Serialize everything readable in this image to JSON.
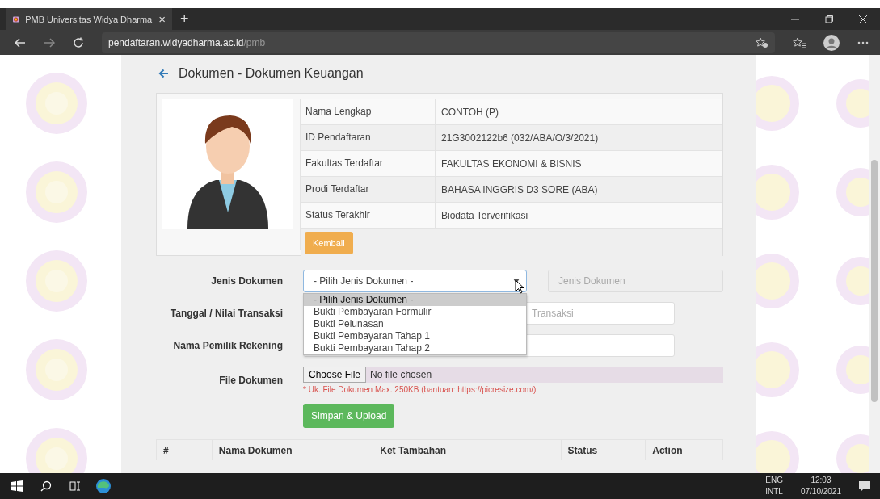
{
  "browser": {
    "tab": {
      "title": "PMB Universitas Widya Dharma",
      "close": "×"
    },
    "new_tab": "+",
    "address": {
      "host": "pendaftaran.widyadharma.ac.id",
      "path": "/pmb"
    }
  },
  "page": {
    "title": "Dokumen - Dokumen Keuangan",
    "profile": {
      "rows": [
        {
          "label": "Nama Lengkap",
          "value": "CONTOH (P)"
        },
        {
          "label": "ID Pendaftaran",
          "value": "21G3002122b6 (032/ABA/O/3/2021)"
        },
        {
          "label": "Fakultas Terdaftar",
          "value": "FAKULTAS EKONOMI & BISNIS"
        },
        {
          "label": "Prodi Terdaftar",
          "value": "BAHASA INGGRIS D3 SORE (ABA)"
        },
        {
          "label": "Status Terakhir",
          "value": "Biodata Terverifikasi"
        }
      ],
      "back_button": "Kembali"
    },
    "form": {
      "fields": [
        {
          "label": "Jenis Dokumen",
          "kind": "select",
          "value": "- Pilih Jenis Dokumen -",
          "side_placeholder": "Jenis Dokumen"
        },
        {
          "label": "Tanggal / Nilai Transaksi",
          "kind": "text",
          "placeholder": "Transaksi"
        },
        {
          "label": "Nama Pemilik Rekening",
          "kind": "text"
        },
        {
          "label": "File Dokumen",
          "kind": "file",
          "button": "Choose File",
          "value": "No file chosen",
          "hint": "* Uk. File Dokumen Max. 250KB (bantuan: https://picresize.com/)"
        }
      ],
      "dropdown": {
        "options": [
          {
            "label": "- Pilih Jenis Dokumen -",
            "selected": true
          },
          {
            "label": "Bukti Pembayaran Formulir",
            "selected": false
          },
          {
            "label": "Bukti Pelunasan",
            "selected": false
          },
          {
            "label": "Bukti Pembayaran Tahap 1",
            "selected": false
          },
          {
            "label": "Bukti Pembayaran Tahap 2",
            "selected": false
          }
        ]
      },
      "submit": "Simpan & Upload"
    },
    "table": {
      "columns": [
        "#",
        "Nama Dokumen",
        "Ket Tambahan",
        "Status",
        "Action"
      ]
    }
  },
  "taskbar": {
    "language": "ENG",
    "layout": "INTL",
    "time": "12:03",
    "date": "07/10/2021"
  }
}
